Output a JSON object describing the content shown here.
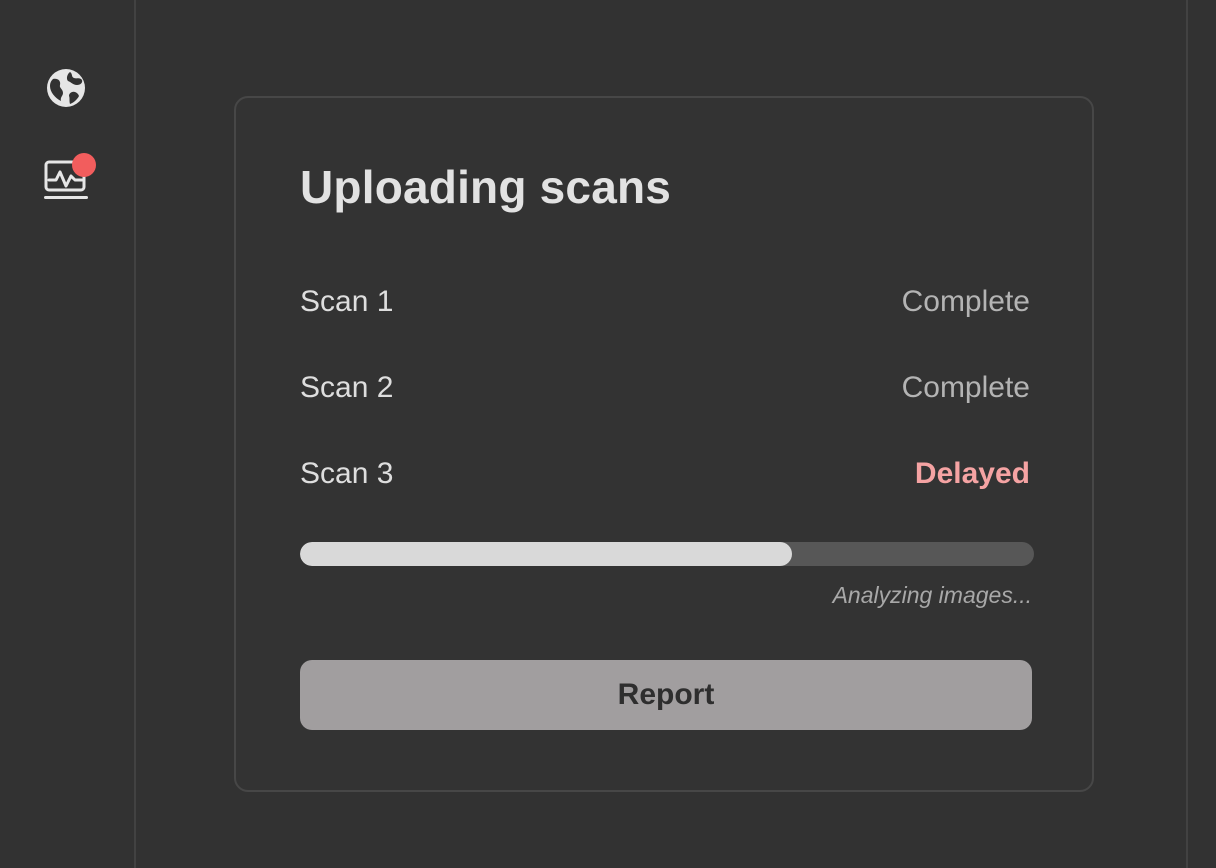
{
  "sidebar": {
    "icons": [
      {
        "name": "globe-icon"
      },
      {
        "name": "monitor-activity-icon",
        "badge_color": "#f25d5d"
      }
    ]
  },
  "card": {
    "title": "Uploading scans",
    "scans": [
      {
        "label": "Scan 1",
        "status": "Complete",
        "state": "complete"
      },
      {
        "label": "Scan 2",
        "status": "Complete",
        "state": "complete"
      },
      {
        "label": "Scan 3",
        "status": "Delayed",
        "state": "delayed"
      }
    ],
    "progress": {
      "fraction": 0.67,
      "caption": "Analyzing images..."
    },
    "report_label": "Report"
  },
  "colors": {
    "background": "#323232",
    "delayed": "#f5a3a3",
    "progress_fill": "#d9d9d9",
    "progress_track": "#575757",
    "button_bg": "#a19e9f"
  }
}
